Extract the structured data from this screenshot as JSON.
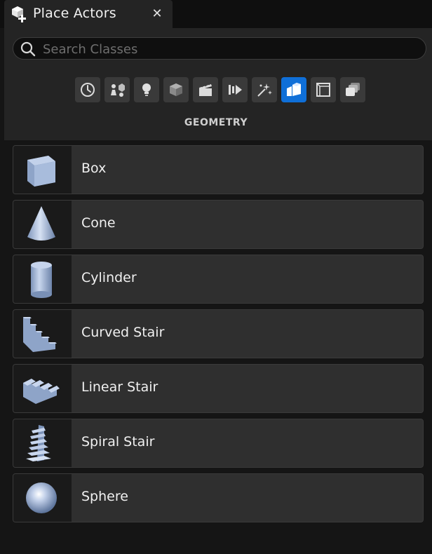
{
  "tab": {
    "title": "Place Actors",
    "close": "✕"
  },
  "search": {
    "placeholder": "Search Classes",
    "value": ""
  },
  "categories": [
    {
      "name": "recently-placed-icon",
      "active": false
    },
    {
      "name": "basic-icon",
      "active": false
    },
    {
      "name": "lights-icon",
      "active": false
    },
    {
      "name": "shapes-icon",
      "active": false
    },
    {
      "name": "cinematic-icon",
      "active": false
    },
    {
      "name": "visual-effects-icon",
      "active": false
    },
    {
      "name": "particles-icon",
      "active": false
    },
    {
      "name": "geometry-icon",
      "active": true
    },
    {
      "name": "volumes-icon",
      "active": false
    },
    {
      "name": "all-classes-icon",
      "active": false
    }
  ],
  "section": {
    "title": "GEOMETRY"
  },
  "items": [
    {
      "label": "Box",
      "icon": "box-icon"
    },
    {
      "label": "Cone",
      "icon": "cone-icon"
    },
    {
      "label": "Cylinder",
      "icon": "cylinder-icon"
    },
    {
      "label": "Curved Stair",
      "icon": "curved-stair-icon"
    },
    {
      "label": "Linear Stair",
      "icon": "linear-stair-icon"
    },
    {
      "label": "Spiral Stair",
      "icon": "spiral-stair-icon"
    },
    {
      "label": "Sphere",
      "icon": "sphere-icon"
    }
  ],
  "colors": {
    "accent": "#0f6fd8",
    "panel": "#242424",
    "item": "#2f2f2f",
    "shape": "#8fa6c9"
  }
}
